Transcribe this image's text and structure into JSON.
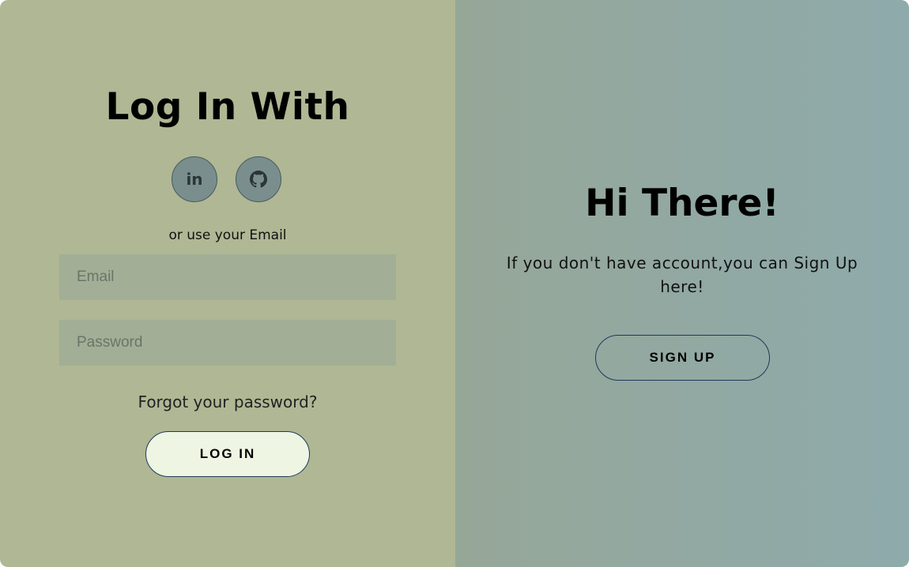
{
  "login_panel": {
    "title": "Log In With",
    "social": [
      {
        "name": "linkedin-icon",
        "glyph": "in"
      },
      {
        "name": "github-icon"
      }
    ],
    "or_text": "or use your Email",
    "email_placeholder": "Email",
    "password_placeholder": "Password",
    "forgot_label": "Forgot your password?",
    "login_label": "LOG IN"
  },
  "signup_panel": {
    "title": "Hi There!",
    "description": "If you don't have account,you can Sign Up here!",
    "signup_label": "SIGN UP"
  },
  "colors": {
    "left_bg": "#afb794",
    "right_bg_start": "#96a798",
    "right_bg_end": "#8eaaab",
    "social_bg": "#7a8e8e",
    "login_btn_bg": "#eef5e3",
    "button_border": "#1e3a5a"
  }
}
